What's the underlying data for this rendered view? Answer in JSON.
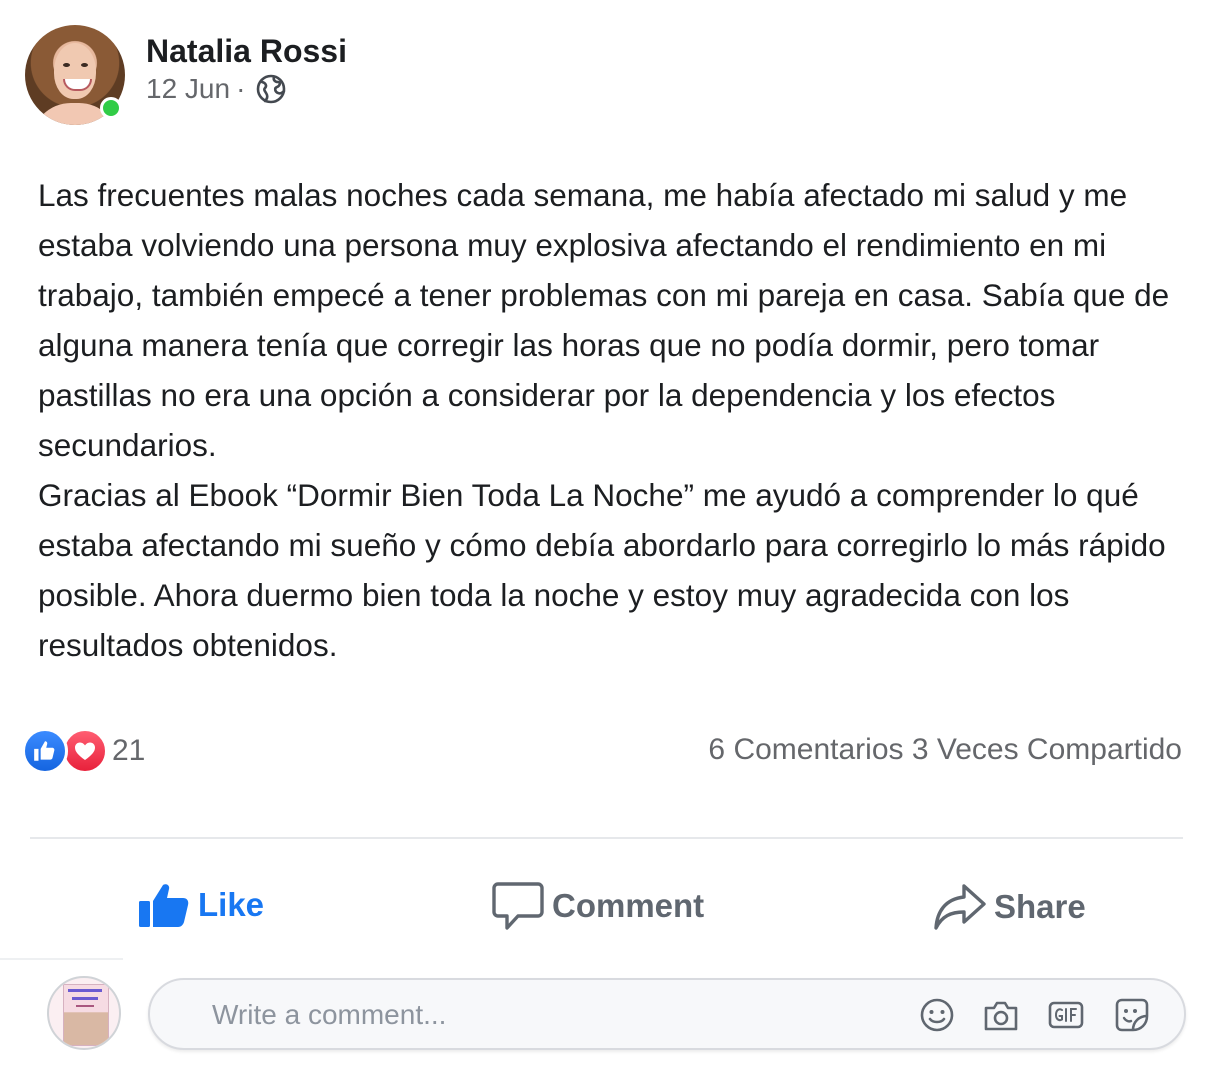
{
  "post": {
    "author": "Natalia Rossi",
    "date": "12 Jun",
    "separator": "·",
    "privacy_icon": "globe-icon",
    "online_status_color": "#31cc46",
    "paragraph_1": "Las frecuentes malas noches cada semana, me había afectado mi salud y me estaba volviendo una persona muy explosiva afectando el rendimiento en mi trabajo, también empecé a tener problemas con mi pareja en casa. Sabía que de alguna manera tenía que corregir las horas que no podía dormir, pero tomar pastillas no era una opción a considerar por la dependencia y los efectos secundarios.",
    "paragraph_2": "Gracias al Ebook “Dormir Bien Toda La Noche” me ayudó a comprender lo qué estaba afectando mi sueño y cómo debía abordarlo para corregirlo lo más rápido posible. Ahora duermo bien toda la noche y estoy muy agradecida con los resultados obtenidos."
  },
  "stats": {
    "reaction_icons": [
      "like-icon",
      "love-icon"
    ],
    "reaction_count": "21",
    "comments_shares": "6 Comentarios 3 Veces Compartido"
  },
  "actions": {
    "like_label": "Like",
    "comment_label": "Comment",
    "share_label": "Share"
  },
  "comment_box": {
    "placeholder": "Write a comment...",
    "icons": [
      "emoji-icon",
      "camera-icon",
      "gif-icon",
      "sticker-icon"
    ]
  },
  "colors": {
    "like_blue": "#1877f2",
    "text_gray": "#65676b",
    "love_red": "#e8213b"
  }
}
